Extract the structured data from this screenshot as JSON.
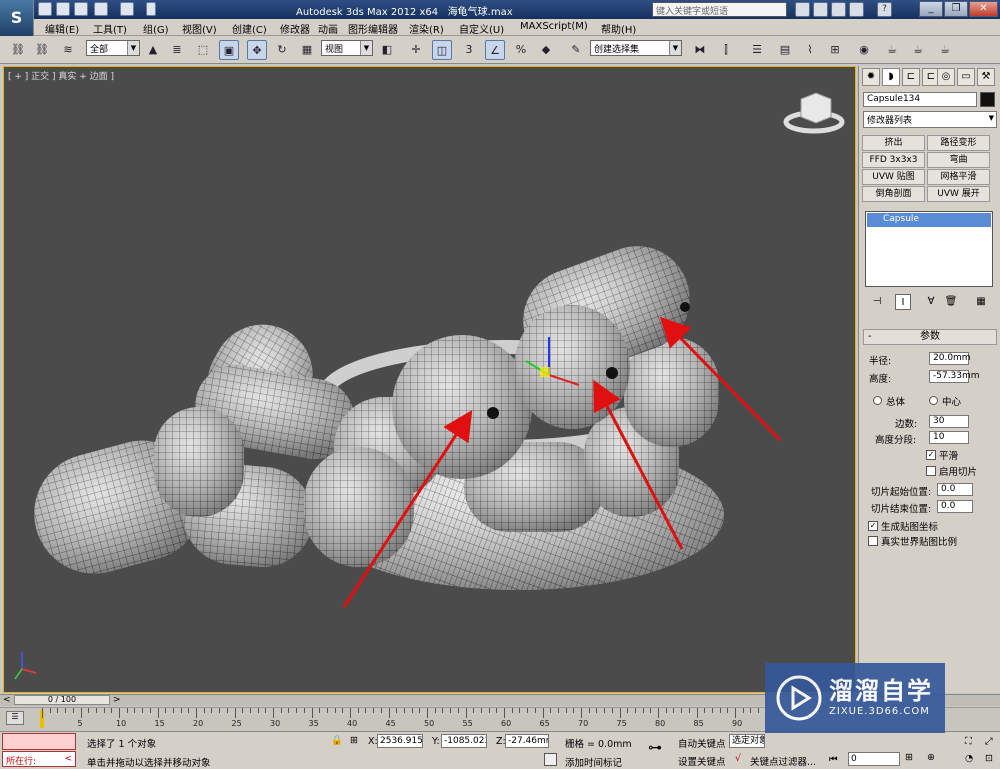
{
  "app": {
    "logo_text": "S",
    "title": "Autodesk 3ds Max  2012 x64",
    "file": "海龟气球.max",
    "search_placeholder": "键入关键字或短语"
  },
  "menus": [
    "编辑(E)",
    "工具(T)",
    "组(G)",
    "视图(V)",
    "创建(C)",
    "修改器",
    "动画",
    "图形编辑器",
    "渲染(R)",
    "自定义(U)",
    "MAXScript(M)",
    "帮助(H)"
  ],
  "toolbar": {
    "filter": "全部",
    "ref_coord": "视图",
    "named_selection": "创建选择集",
    "snap_label": "3",
    "percent_label": "%"
  },
  "viewport": {
    "label": "[ + ] 正交 ] 真实 + 边面 ]"
  },
  "panel": {
    "object_name": "Capsule134",
    "modifier_list": "修改器列表",
    "modifier_buttons": [
      "挤出",
      "路径变形",
      "FFD 3x3x3",
      "弯曲",
      "UVW 贴图",
      "网格平滑",
      "倒角剖面",
      "UVW 展开"
    ],
    "stack_item": "Capsule",
    "rollout_title": "参数",
    "radius_label": "半径:",
    "radius_value": "20.0mm",
    "height_label": "高度:",
    "height_value": "-57.33mm",
    "overall_label": "总体",
    "center_label": "中心",
    "sides_label": "边数:",
    "sides_value": "30",
    "height_segs_label": "高度分段:",
    "height_segs_value": "10",
    "smooth_label": "平滑",
    "slice_on_label": "启用切片",
    "slice_from_label": "切片起始位置:",
    "slice_from_value": "0.0",
    "slice_to_label": "切片结束位置:",
    "slice_to_value": "0.0",
    "gen_map_label": "生成贴图坐标",
    "real_world_label": "真实世界贴图比例"
  },
  "timeline": {
    "slider": "0 / 100",
    "ticks": [
      "5",
      "10",
      "15",
      "20",
      "25",
      "30",
      "35",
      "40",
      "45",
      "50",
      "55",
      "60",
      "65",
      "70",
      "75",
      "80",
      "85",
      "90"
    ]
  },
  "status": {
    "running": "所在行:",
    "selected": "选择了 1 个对象",
    "prompt": "单击并拖动以选择并移动对象",
    "x_label": "X:",
    "x_value": "2536.915m",
    "y_label": "Y:",
    "y_value": "-1085.023",
    "z_label": "Z:",
    "z_value": "-27.46mm",
    "grid": "栅格 = 0.0mm",
    "add_time_tag": "添加时间标记",
    "auto_key": "自动关键点",
    "selected_obj": "选定对象",
    "set_key": "设置关键点",
    "key_filters": "关键点过滤器...",
    "frame": "0"
  },
  "watermark": {
    "title": "溜溜自学",
    "url": "ZIXUE.3D66.COM"
  },
  "colors": {
    "viewport_bg": "#4b4b4b",
    "active_border": "#e8b400",
    "arrow": "#e01010",
    "stack_select": "#5a8bd5"
  }
}
